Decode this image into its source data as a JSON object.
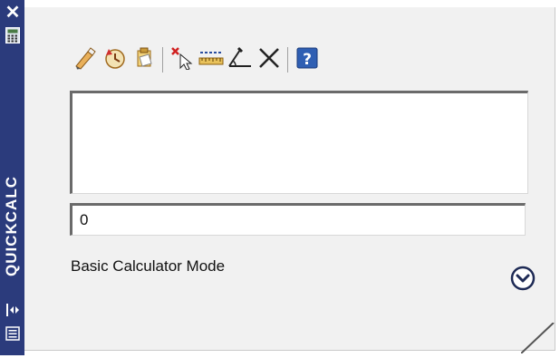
{
  "palette": {
    "title_bar": "#2b3b7c",
    "panel_bg": "#f1f1f1",
    "field_border": "#6a6a6a",
    "help_blue": "#2f5fb3"
  },
  "title_bar": {
    "title": "QUICKCALC",
    "close_glyph": "✕",
    "icons": [
      "close-icon",
      "calculator-icon",
      "auto-hide-icon",
      "properties-icon"
    ]
  },
  "toolbar": {
    "tools": [
      {
        "name": "clear-tool",
        "icon": "eraser-icon"
      },
      {
        "name": "clear-history-tool",
        "icon": "history-clock-icon"
      },
      {
        "name": "paste-to-command-line-tool",
        "icon": "paste-icon"
      },
      {
        "name": "get-coordinates-tool",
        "icon": "pick-point-icon"
      },
      {
        "name": "distance-tool",
        "icon": "ruler-icon"
      },
      {
        "name": "angle-tool",
        "icon": "angle-icon"
      },
      {
        "name": "intersection-tool",
        "icon": "intersection-icon"
      },
      {
        "name": "help-tool",
        "icon": "help-icon"
      }
    ]
  },
  "history": {
    "entries": []
  },
  "input": {
    "value": "0"
  },
  "mode": {
    "label": "Basic Calculator Mode",
    "expand_icon": "chevron-down-icon"
  }
}
